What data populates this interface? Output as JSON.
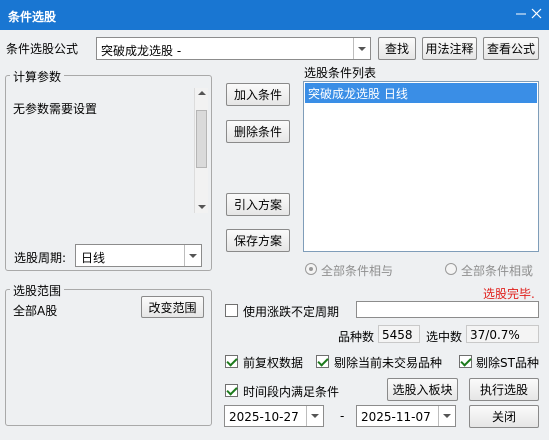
{
  "window": {
    "title": "条件选股"
  },
  "formula": {
    "label": "条件选股公式",
    "value": "突破成龙选股  -",
    "find_button": "查找",
    "usage_button": "用法注释",
    "view_button": "查看公式"
  },
  "params": {
    "group_label": "计算参数",
    "message": "无参数需要设置",
    "period_label": "选股周期:",
    "period_value": "日线"
  },
  "actions": {
    "add_condition": "加入条件",
    "delete_condition": "删除条件",
    "import_plan": "引入方案",
    "save_plan": "保存方案"
  },
  "conditions": {
    "label": "选股条件列表",
    "items": [
      "突破成龙选股  日线"
    ],
    "radio_and": "全部条件相与",
    "radio_or": "全部条件相或",
    "status": "选股完毕."
  },
  "range": {
    "group_label": "选股范围",
    "value": "全部A股",
    "change_button": "改变范围"
  },
  "options": {
    "use_volatile_period": "使用涨跌不定周期",
    "volatile_period_value": "",
    "variety_count_label": "品种数",
    "variety_count": "5458",
    "selected_label": "选中数",
    "selected_value": "37/0.7%",
    "forward_adjust": "前复权数据",
    "exclude_untraded": "剔除当前未交易品种",
    "exclude_st": "剔除ST品种",
    "time_range_condition": "时间段内满足条件",
    "date_start": "2025-10-27",
    "date_separator": "-",
    "date_end": "2025-11-07"
  },
  "footer": {
    "to_board_button": "选股入板块",
    "run_button": "执行选股",
    "close_button": "关闭"
  },
  "colors": {
    "titlebar": "#1976d2",
    "selection": "#3a8ee6",
    "status": "#e0201c"
  }
}
